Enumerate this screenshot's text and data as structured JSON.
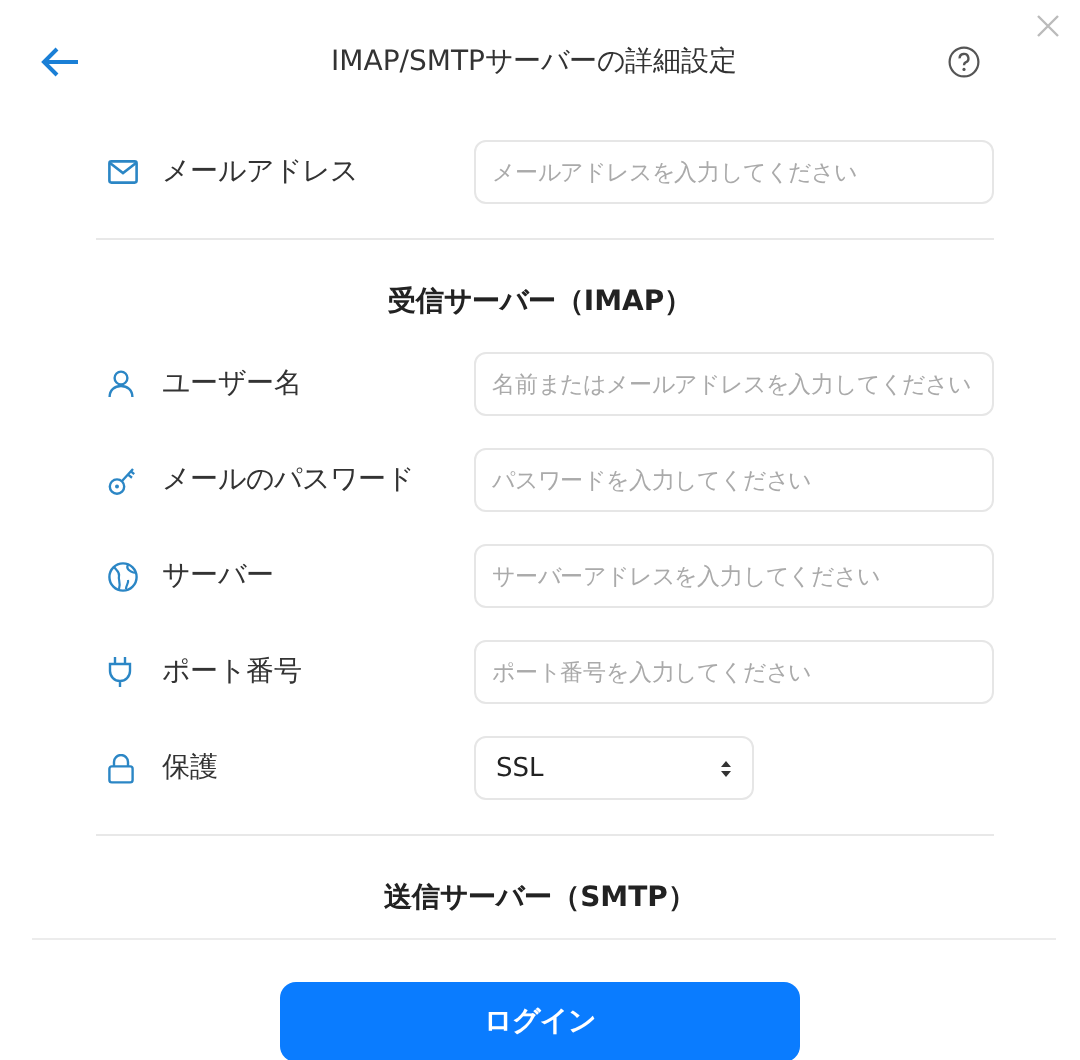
{
  "header": {
    "title": "IMAP/SMTPサーバーの詳細設定"
  },
  "sections": [
    {
      "fields": [
        {
          "kind": "input",
          "label": "メールアドレス",
          "placeholder": "メールアドレスを入力してください"
        }
      ]
    },
    {
      "heading": "受信サーバー（IMAP）",
      "fields": [
        {
          "kind": "input",
          "label": "ユーザー名",
          "placeholder": "名前またはメールアドレスを入力してください"
        },
        {
          "kind": "input",
          "label": "メールのパスワード",
          "placeholder": "パスワードを入力してください"
        },
        {
          "kind": "input",
          "label": "サーバー",
          "placeholder": "サーバーアドレスを入力してください"
        },
        {
          "kind": "input",
          "label": "ポート番号",
          "placeholder": "ポート番号を入力してください"
        },
        {
          "kind": "select",
          "label": "保護",
          "value": "SSL"
        }
      ]
    },
    {
      "heading": "送信サーバー（SMTP）"
    }
  ],
  "login_button": "ログイン"
}
